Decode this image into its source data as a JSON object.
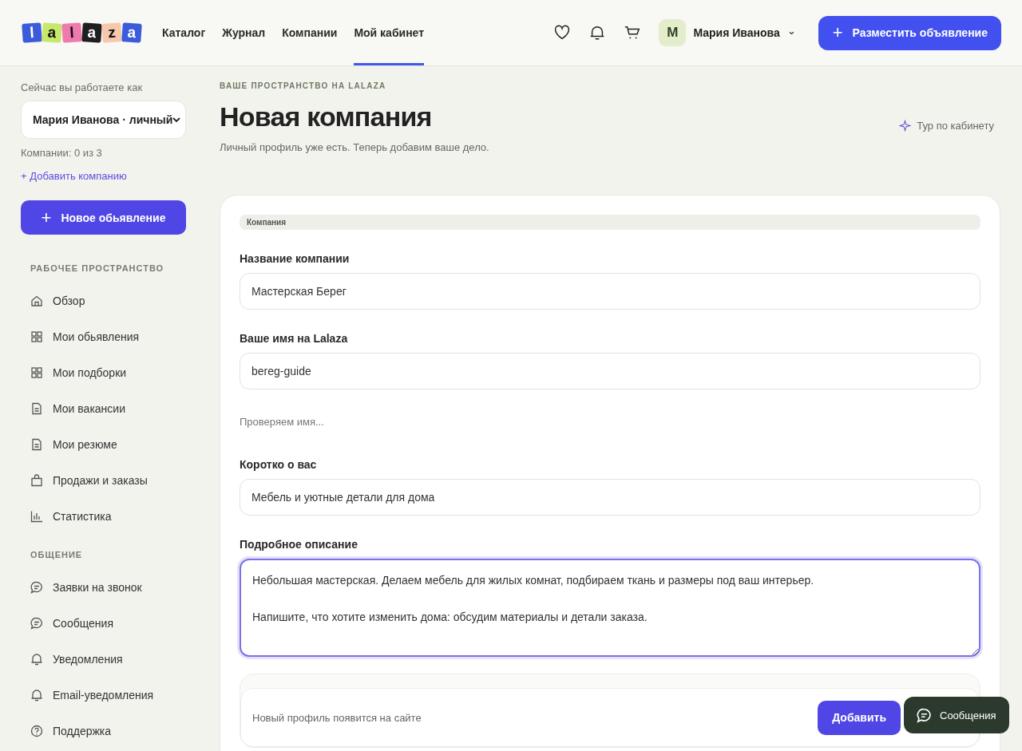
{
  "logo": {
    "letters": [
      {
        "char": "l",
        "color": "#3b5bdb"
      },
      {
        "char": "a",
        "color": "#c6e86b"
      },
      {
        "char": "l",
        "color": "#f07ab0"
      },
      {
        "char": "a",
        "color": "#1f1f1f"
      },
      {
        "char": "z",
        "color": "#f6c9ad"
      },
      {
        "char": "a",
        "color": "#3b5bdb"
      }
    ]
  },
  "nav": [
    {
      "label": "Каталог",
      "selected": false
    },
    {
      "label": "Журнал",
      "selected": false
    },
    {
      "label": "Компании",
      "selected": false
    },
    {
      "label": "Мой кабинет",
      "selected": true
    }
  ],
  "user": {
    "initial": "М",
    "name": "Мария Иванова",
    "caret": "⌄"
  },
  "post_button": {
    "icon": "+",
    "label": "Разместить объявление"
  },
  "sidebar": {
    "working_as_label": "Сейчас вы работаете как",
    "account_select": "Мария Иванова · личный",
    "companies_count": "Компании: 0 из 3",
    "add_company_link": "+ Добавить компанию",
    "new_listing_button": {
      "icon": "+",
      "label": "Новое обьявление"
    },
    "sections": [
      {
        "title": "РАБОЧЕЕ ПРОСТРАНСТВО",
        "items": [
          {
            "label": "Обзор",
            "kind": "home"
          },
          {
            "label": "Мои обьявления",
            "kind": "grid"
          },
          {
            "label": "Мои подборки",
            "kind": "grid"
          },
          {
            "label": "Мои вакансии",
            "kind": "doc"
          },
          {
            "label": "Мои резюме",
            "kind": "doc"
          },
          {
            "label": "Продажи и заказы",
            "kind": "bag"
          },
          {
            "label": "Статистика",
            "kind": "chart"
          }
        ]
      },
      {
        "title": "ОБЩЕНИЕ",
        "items": [
          {
            "label": "Заявки на звонок",
            "kind": "chat"
          },
          {
            "label": "Сообщения",
            "kind": "chat"
          },
          {
            "label": "Уведомления",
            "kind": "bell"
          },
          {
            "label": "Email-уведомления",
            "kind": "bell"
          },
          {
            "label": "Поддержка",
            "kind": "help"
          }
        ]
      }
    ]
  },
  "page": {
    "eyebrow": "ВАШЕ ПРОСТРАНСТВО НА LALAZA",
    "title": "Новая компания",
    "subtitle": "Личный профиль уже есть. Теперь добавим ваше дело.",
    "tour_link": "Тур по кабинету"
  },
  "form": {
    "section_label": "Компания",
    "fields": [
      {
        "kind": "input",
        "label": "Название компании",
        "value": "Мастерская Берег",
        "focused": false
      },
      {
        "kind": "input",
        "label": "Ваше имя на Lalaza",
        "value": "bereg-guide",
        "focused": false,
        "hint": "Проверяем имя..."
      },
      {
        "kind": "input",
        "label": "Коротко о вас",
        "value": "Мебель и уютные детали для дома",
        "focused": false
      },
      {
        "kind": "textarea",
        "label": "Подробное описание",
        "value": "Небольшая мастерская. Делаем мебель для жилых комнат, подбираем ткань и размеры под ваш интерьер.\n\nНапишите, что хотите изменить дома: обсудим материалы и детали заказа.",
        "focused": true
      }
    ]
  },
  "footer_bar": {
    "note": "Новый профиль появится на сайте",
    "button": "Добавить"
  },
  "chat_chip": {
    "label": "Сообщения"
  }
}
